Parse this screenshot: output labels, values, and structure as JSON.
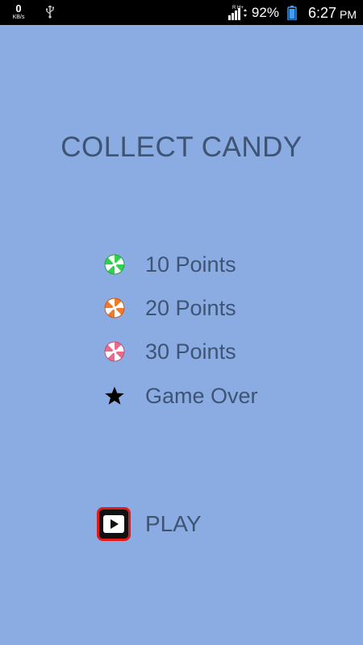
{
  "status_bar": {
    "net_speed_value": "0",
    "net_speed_unit": "KB/s",
    "signal_label": "R H+",
    "battery_percent": "92%",
    "time": "6:27",
    "ampm": "PM"
  },
  "game": {
    "title": "COLLECT CANDY",
    "legend": [
      {
        "icon": "green-candy-icon",
        "label": "10 Points",
        "color": "#2fd24a"
      },
      {
        "icon": "orange-candy-icon",
        "label": "20 Points",
        "color": "#f07a2a"
      },
      {
        "icon": "pink-candy-icon",
        "label": "30 Points",
        "color": "#e86a8e"
      },
      {
        "icon": "star-icon",
        "label": "Game Over",
        "color": "#000000"
      }
    ],
    "play_label": "PLAY"
  },
  "colors": {
    "background": "#8aace3",
    "text": "#3f5373",
    "play_border": "#e01b1b"
  }
}
